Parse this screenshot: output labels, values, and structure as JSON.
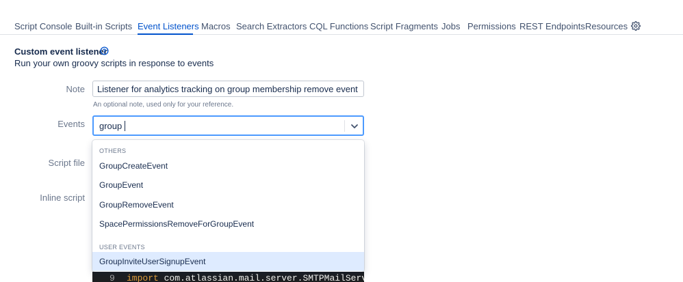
{
  "nav": {
    "tabs": [
      {
        "label": "Script Console"
      },
      {
        "label": "Built-in Scripts"
      },
      {
        "label": "Event Listeners",
        "active": true
      },
      {
        "label": "Macros"
      },
      {
        "label": "Search Extractors"
      },
      {
        "label": "CQL Functions"
      },
      {
        "label": "Script Fragments"
      },
      {
        "label": "Jobs"
      },
      {
        "label": "Permissions"
      },
      {
        "label": "REST Endpoints"
      },
      {
        "label": "Resources"
      }
    ],
    "settings_icon": "gear-icon"
  },
  "header": {
    "title": "Custom event listener",
    "help_icon": "question-circle-icon",
    "subtitle": "Run your own groovy scripts in response to events"
  },
  "form": {
    "note": {
      "label": "Note",
      "value": "Listener for analytics tracking on group membership remove event",
      "help": "An optional note, used only for your reference."
    },
    "events": {
      "label": "Events",
      "value": "group",
      "icon": "chevron-down-icon"
    },
    "script_file": {
      "label": "Script file"
    },
    "inline_script": {
      "label": "Inline script",
      "code_line_number": "9",
      "code_keyword": "import",
      "code_text": " com.atlassian.mail.server.SMTPMailServer;"
    }
  },
  "dropdown": {
    "groups": [
      {
        "heading": "OTHERS",
        "options": [
          {
            "label": "GroupCreateEvent"
          },
          {
            "label": "GroupEvent"
          },
          {
            "label": "GroupRemoveEvent"
          },
          {
            "label": "SpacePermissionsRemoveForGroupEvent"
          }
        ]
      },
      {
        "heading": "USER EVENTS",
        "options": [
          {
            "label": "GroupInviteUserSignupEvent",
            "focused": true
          }
        ]
      }
    ]
  },
  "colors": {
    "accent": "#0052cc",
    "focus_border": "#4c9aff",
    "option_focus_bg": "#deebff"
  }
}
